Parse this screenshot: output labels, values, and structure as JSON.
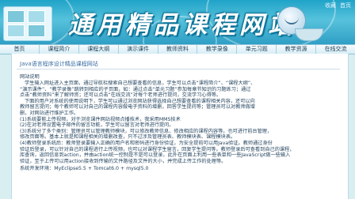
{
  "banner": {
    "title": "通用精品课程网站",
    "util_links": [
      "收藏",
      "首页"
    ]
  },
  "nav": {
    "items": [
      "首页",
      "课程简介",
      "课程大纲",
      "演示课件",
      "教师资料",
      "教学录像",
      "单元习题",
      "教学资源",
      "在线交流"
    ]
  },
  "content": {
    "page_heading": "Java语言程序设计精品课程网站",
    "section_title": "网站说明",
    "paragraphs": [
      "学生输入网址进入主页面，通过导航栏搜索自己想要查看的信息，学生可以点击“课程简介”、“课程大纲”、",
      "“演示课件”、“教学录像”跳转到相应的子页面，如：通过点击“单元习题”参加每章节知识的习题练习；通过",
      "点击“教师资料”来了解师资；还可以点击“在线交流”对每个老师进行提问，交流学习心得等。",
      "下面的用户对系统的使用说明下，学生可以通过浏览网站获得选择自己想要查看的课程相关内容，还可以向",
      "教师留言提问；每个教师可以对自己的课程内容做电子资料的增删，回答学生提问等；管理员可以对教师做增",
      "删，对网站进行维护工作。",
      "(1)系统要能上传视频，对于浏览课件网站视频点播技术，我采用MMS技术",
      "(2)在对老师设置电子邮件的留言功能，学生可以留言对老师进行提问。",
      "(3)系统分了多个类别：管理员可以管理教师模块，可以修改教师信息、修改相应的课程内容等。也可进行前台管理，",
      "修改页面等。基本上就是和课程相关的增删改查，只不过涉及管理员表、教师模块表、课程模块表。",
      "(4)教师登录系统后：教师登录要输入正确的用户名和密码进行身份验证，为安全提前可以用Java验证。教师通过身份",
      "验证后登录，可以针对自己的课程进行上传视频，也可以对课程学生留言，回复学生提问等。教师登录后可查看到自己的课程，",
      "库查询，返回信息到action，并由action统一控制是不是可以登录，此外在页面上利用一些表单和一些JavaScript做一些输入",
      "验证，至于上传可以用action接收到传输的文件路径及文件的大小，并完成上传工作的处理等。"
    ],
    "tech_line": "系统开发环境：MyEclipse5.5 + Tomcat6.0 + mysql5.0"
  }
}
